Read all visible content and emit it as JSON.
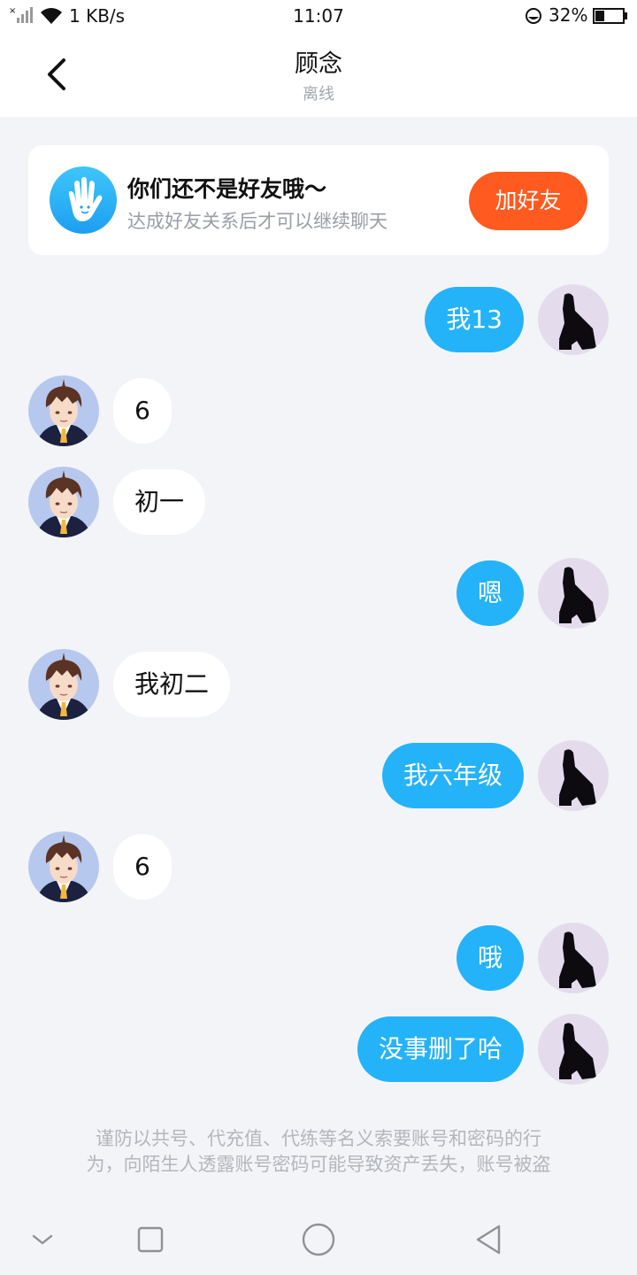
{
  "status_bar": {
    "net_speed": "1 KB/s",
    "time": "11:07",
    "battery_percent": "32%",
    "battery_level": 0.32
  },
  "header": {
    "title": "顾念",
    "subtitle": "离线"
  },
  "friend_card": {
    "title": "你们还不是好友哦～",
    "description": "达成好友关系后才可以继续聊天",
    "button_label": "加好友",
    "button_color": "#ff5a1f"
  },
  "messages": [
    {
      "sender": "me",
      "text": "我13"
    },
    {
      "sender": "them",
      "text": "6"
    },
    {
      "sender": "them",
      "text": "初一"
    },
    {
      "sender": "me",
      "text": "嗯"
    },
    {
      "sender": "them",
      "text": "我初二"
    },
    {
      "sender": "me",
      "text": "我六年级"
    },
    {
      "sender": "them",
      "text": "6"
    },
    {
      "sender": "me",
      "text": "哦"
    },
    {
      "sender": "me",
      "text": "没事删了哈"
    }
  ],
  "warning": {
    "line1": "谨防以共号、代充值、代练等名义索要账号和密码的行",
    "line2": "为，向陌生人透露账号密码可能导致资产丢失，账号被盗"
  },
  "colors": {
    "my_bubble": "#24b3f8",
    "their_bubble": "#ffffff",
    "background": "#f3f4f7"
  },
  "icons": {
    "back": "chevron-left-icon",
    "friend_card": "hand-wave-icon",
    "nav_collapse": "chevron-down-icon",
    "nav_recents": "square-icon",
    "nav_home": "circle-icon",
    "nav_back": "triangle-back-icon"
  }
}
